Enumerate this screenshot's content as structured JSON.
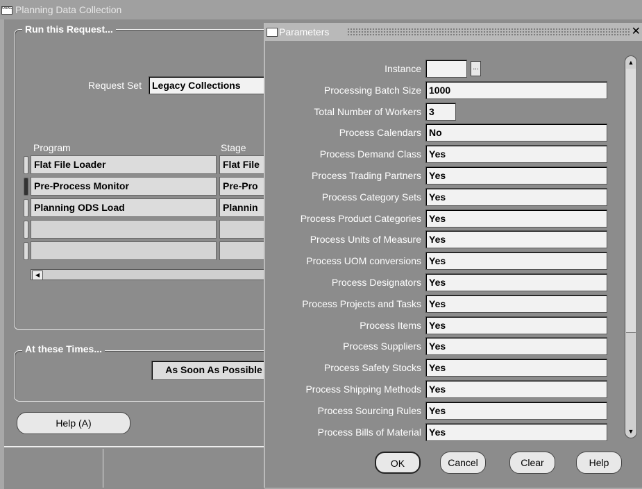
{
  "main_window": {
    "title": "Planning Data Collection",
    "run_request": {
      "legend": "Run this Request...",
      "request_set_label": "Request Set",
      "request_set_value": "Legacy Collections",
      "columns": [
        "Program",
        "Stage"
      ],
      "rows": [
        {
          "program": "Flat File Loader",
          "stage": "Flat File"
        },
        {
          "program": "Pre-Process Monitor",
          "stage": "Pre-Pro"
        },
        {
          "program": "Planning ODS Load",
          "stage": "Plannin"
        },
        {
          "program": "",
          "stage": ""
        },
        {
          "program": "",
          "stage": ""
        }
      ]
    },
    "at_times": {
      "legend": "At these Times...",
      "value": "As Soon As Possible"
    },
    "help_button": "Help (A)"
  },
  "dialog": {
    "title": "Parameters",
    "close_glyph": "✕",
    "lov_glyph": "...",
    "params": [
      {
        "label": "Instance",
        "value": ""
      },
      {
        "label": "Processing Batch Size",
        "value": "1000"
      },
      {
        "label": "Total Number of Workers",
        "value": "3"
      },
      {
        "label": "Process Calendars",
        "value": "No"
      },
      {
        "label": "Process Demand Class",
        "value": "Yes"
      },
      {
        "label": "Process Trading Partners",
        "value": "Yes"
      },
      {
        "label": "Process  Category Sets",
        "value": "Yes"
      },
      {
        "label": "Process Product Categories",
        "value": "Yes"
      },
      {
        "label": "Process Units of Measure",
        "value": "Yes"
      },
      {
        "label": "Process UOM conversions",
        "value": "Yes"
      },
      {
        "label": "Process Designators",
        "value": "Yes"
      },
      {
        "label": "Process Projects and Tasks",
        "value": "Yes"
      },
      {
        "label": "Process Items",
        "value": "Yes"
      },
      {
        "label": "Process Suppliers",
        "value": "Yes"
      },
      {
        "label": "Process Safety Stocks",
        "value": "Yes"
      },
      {
        "label": "Process Shipping Methods",
        "value": "Yes"
      },
      {
        "label": "Process Sourcing Rules",
        "value": "Yes"
      },
      {
        "label": "Process Bills of Material",
        "value": "Yes"
      }
    ],
    "buttons": {
      "ok": "OK",
      "cancel": "Cancel",
      "clear": "Clear",
      "help": "Help"
    }
  },
  "colors": {
    "window_bg": "#8c8c8c",
    "field_bg": "#f2f2f2",
    "label_text": "#ffffff"
  }
}
